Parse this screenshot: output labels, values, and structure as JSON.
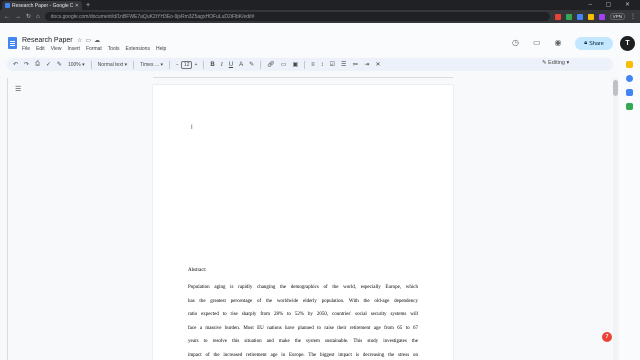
{
  "browser": {
    "tab_title": "Research Paper - Google Docs",
    "url": "docs.google.com/document/d/1nBFWE7aQuK2tYH3Eo-9jsRm3Z5agxHOFuLuD2iFlbK/edit#",
    "vpn_label": "VPN"
  },
  "doc": {
    "title": "Research Paper",
    "menu": [
      "File",
      "Edit",
      "View",
      "Insert",
      "Format",
      "Tools",
      "Extensions",
      "Help"
    ],
    "share_label": "Share",
    "avatar_letter": "T"
  },
  "toolbar": {
    "zoom": "100%",
    "style": "Normal text",
    "font": "Times ...",
    "font_size": "12",
    "mode": "Editing"
  },
  "page": {
    "abstract_label": "Abstract:",
    "abstract_lines": [
      "Population aging is rapidly changing the demographics of the world, especially Europe, which",
      "has the greatest percentage of the worldwide elderly population. With the old-age dependency",
      "ratio expected to rise sharply from 28% to 52% by 2050, countries' social security systems will",
      "face a massive burden. Most EU nations have planned to raise their retirement age from 65 to 67",
      "years to resolve this situation and make the system sustainable. This study investigates the",
      "impact of the increased retirement age in Europe. The biggest impact is decreasing the stress on"
    ]
  },
  "colors": {
    "accent": "#4285f4",
    "share_bg": "#c2e7ff",
    "toolbar_bg": "#edf2fa"
  }
}
